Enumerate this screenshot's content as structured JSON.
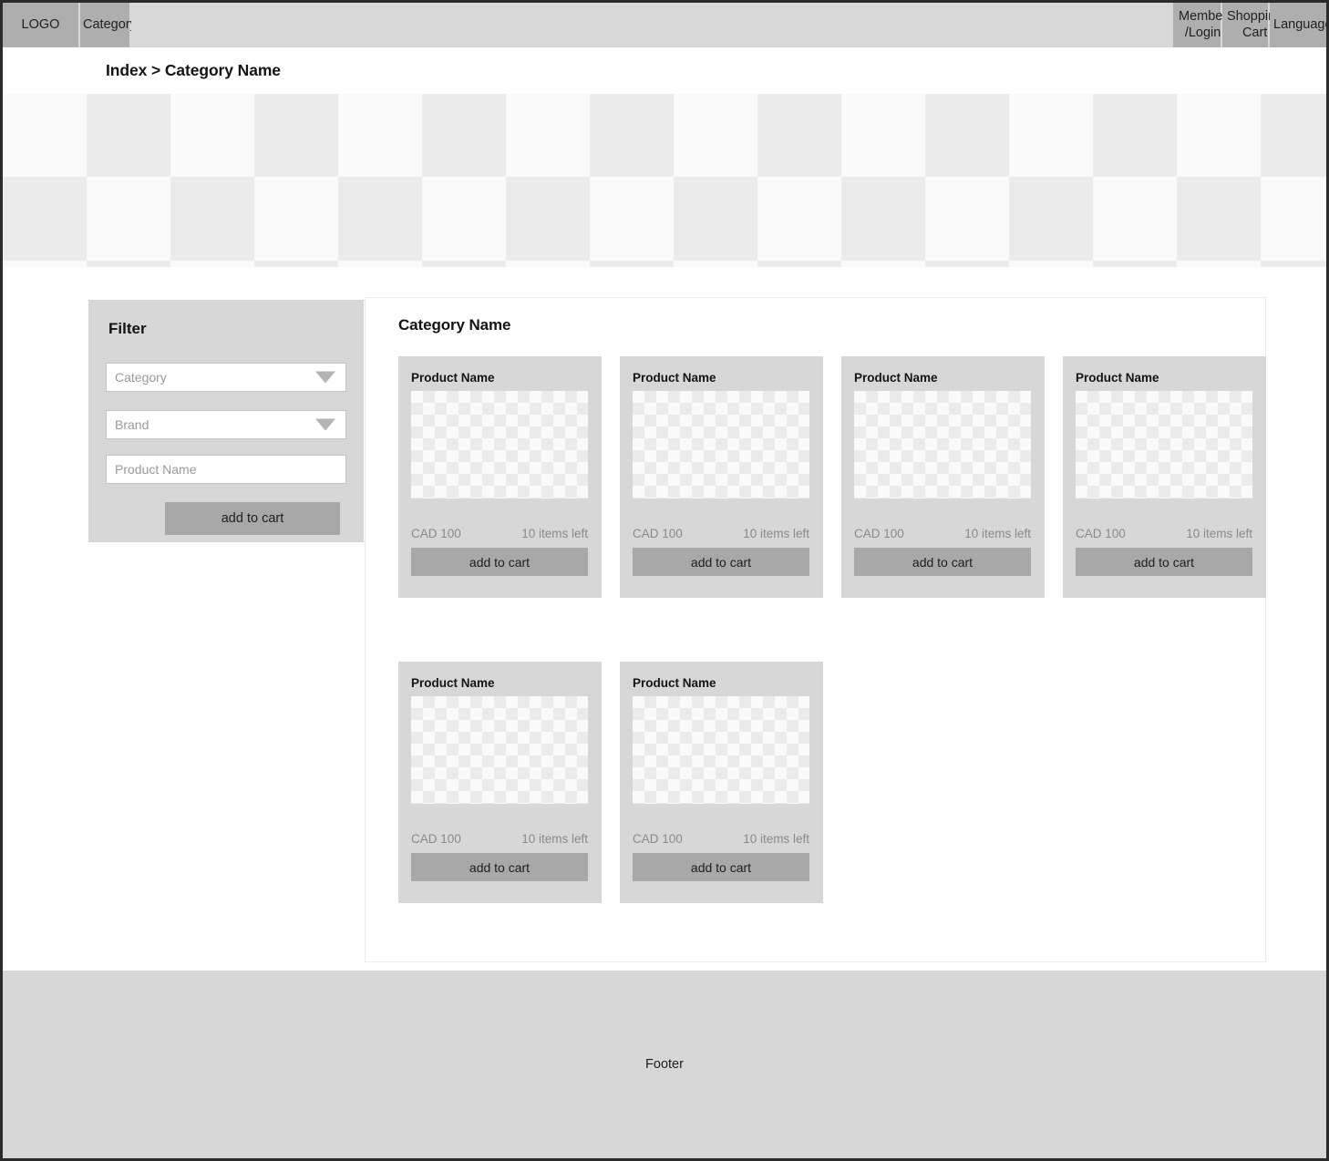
{
  "topnav": {
    "logo": "LOGO",
    "category": "Category",
    "member_login": "Member /Login",
    "shopping_cart": "Shopping Cart",
    "language": "Language"
  },
  "breadcrumb": {
    "text": "Index > Category Name"
  },
  "banner": {
    "placeholder_name": "banner-image-placeholder"
  },
  "filter": {
    "title": "Filter",
    "category_placeholder": "Category",
    "brand_placeholder": "Brand",
    "product_name_placeholder": "Product Name",
    "category_value": "",
    "brand_value": "",
    "product_name_value": "",
    "submit_label": "add to cart"
  },
  "products_panel": {
    "title": "Category Name",
    "items": [
      {
        "name": "Product Name",
        "price": "CAD 100",
        "stock": "10 items left",
        "button": "add to cart"
      },
      {
        "name": "Product Name",
        "price": "CAD 100",
        "stock": "10 items left",
        "button": "add to cart"
      },
      {
        "name": "Product Name",
        "price": "CAD 100",
        "stock": "10 items left",
        "button": "add to cart"
      },
      {
        "name": "Product Name",
        "price": "CAD 100",
        "stock": "10 items left",
        "button": "add to cart"
      },
      {
        "name": "Product Name",
        "price": "CAD 100",
        "stock": "10 items left",
        "button": "add to cart"
      },
      {
        "name": "Product Name",
        "price": "CAD 100",
        "stock": "10 items left",
        "button": "add to cart"
      }
    ]
  },
  "footer": {
    "label": "Footer"
  },
  "colors": {
    "nav_block": "#aeaeae",
    "nav_bar": "#d8d8d8",
    "panel_gray": "#d7d7d7",
    "button_gray": "#a8a8a8",
    "checker_light": "#fafafa",
    "checker_dark": "#ebebeb",
    "border_dark": "#2b2b2b"
  }
}
